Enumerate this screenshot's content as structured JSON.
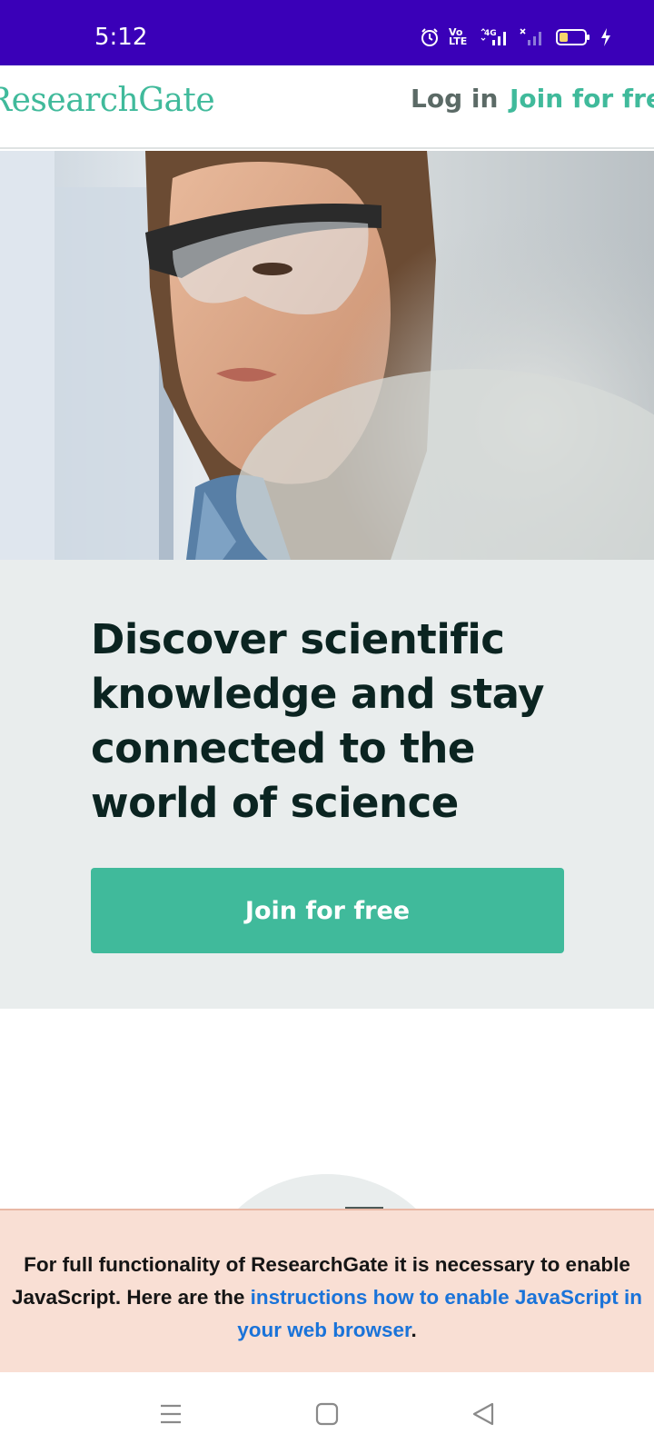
{
  "status_bar": {
    "time": "5:12",
    "volte_label": "Vo LTE",
    "network_label": "4G",
    "icons": [
      "alarm-icon",
      "volte-icon",
      "signal-4g-icon",
      "signal-no-service-icon",
      "battery-icon",
      "charging-icon"
    ],
    "background_color": "#3a00b8"
  },
  "header": {
    "logo_text": "ResearchGate",
    "login_label": "Log in",
    "join_label": "Join for free"
  },
  "hero": {
    "image_alt": "Scientist wearing safety glasses in a laboratory",
    "title": "Discover scientific knowledge and stay connected to the world of science",
    "cta_label": "Join for free"
  },
  "notice": {
    "text_before": "For full functionality of ResearchGate it is necessary to enable JavaScript. Here are the ",
    "link_text": "instructions how to enable JavaScript in your web browser",
    "text_after": "."
  },
  "navigation_bar": {
    "buttons": [
      "menu-icon",
      "home-icon",
      "back-icon"
    ]
  },
  "colors": {
    "brand": "#40ba9b",
    "status_bar": "#3a00b8",
    "hero_panel": "#e9eded",
    "notice_bg": "#f9dfd4",
    "link": "#1a73d9",
    "title_text": "#0b2421"
  }
}
